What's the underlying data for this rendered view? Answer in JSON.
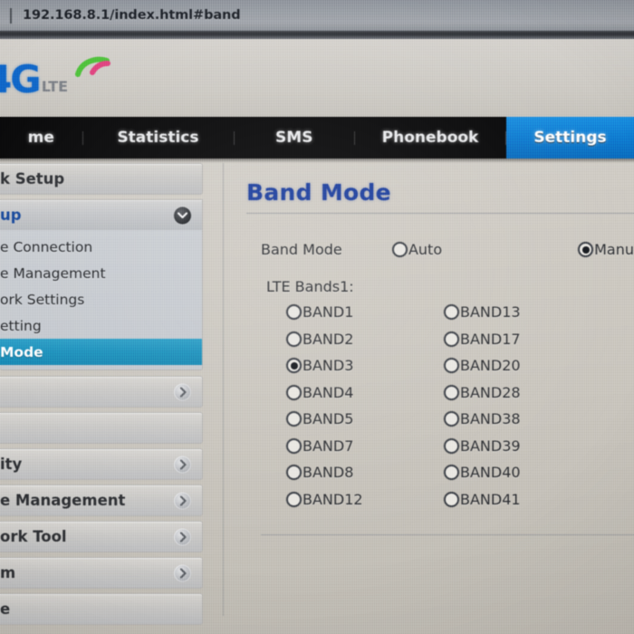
{
  "browser": {
    "url": "192.168.8.1/index.html#band"
  },
  "brand": {
    "primary_text": "4G",
    "secondary_text": "LTE",
    "color_4g": "#1066c8",
    "color_lte": "#7b7f86"
  },
  "nav": {
    "active_color": "#0f7bd0",
    "items": [
      {
        "label": "me",
        "active": false
      },
      {
        "label": "Statistics",
        "active": false
      },
      {
        "label": "SMS",
        "active": false
      },
      {
        "label": "Phonebook",
        "active": false
      },
      {
        "label": "Settings",
        "active": true
      }
    ]
  },
  "sidebar": {
    "selected_color": "#1b90bc",
    "sections": [
      {
        "label": "k Setup",
        "open": false,
        "chevron": "chevron-right-icon",
        "has_chevron": false,
        "items": []
      },
      {
        "label": "up",
        "open": true,
        "chevron": "chevron-down-icon",
        "has_chevron": true,
        "items": [
          {
            "label": "e Connection",
            "selected": false
          },
          {
            "label": "e Management",
            "selected": false
          },
          {
            "label": "ork Settings",
            "selected": false
          },
          {
            "label": "etting",
            "selected": false
          },
          {
            "label": "Mode",
            "selected": true
          }
        ]
      },
      {
        "label": "",
        "open": false,
        "chevron": "chevron-right-icon",
        "has_chevron": true,
        "items": []
      },
      {
        "label": "",
        "open": false,
        "chevron": "chevron-right-icon",
        "has_chevron": false,
        "items": []
      },
      {
        "label": "ity",
        "open": false,
        "chevron": "chevron-right-icon",
        "has_chevron": true,
        "items": []
      },
      {
        "label": "e Management",
        "open": false,
        "chevron": "chevron-right-icon",
        "has_chevron": true,
        "items": []
      },
      {
        "label": "ork Tool",
        "open": false,
        "chevron": "chevron-right-icon",
        "has_chevron": true,
        "items": []
      },
      {
        "label": "m",
        "open": false,
        "chevron": "chevron-right-icon",
        "has_chevron": true,
        "items": []
      },
      {
        "label": "e",
        "open": false,
        "chevron": "chevron-right-icon",
        "has_chevron": false,
        "items": []
      }
    ]
  },
  "content": {
    "title": "Band Mode",
    "band_mode_label": "Band Mode",
    "mode_options": [
      {
        "label": "Auto",
        "selected": false
      },
      {
        "label": "Manu",
        "selected": true
      }
    ],
    "lte_bands_label": "LTE Bands1:",
    "bands_left": [
      {
        "label": "BAND1",
        "selected": false
      },
      {
        "label": "BAND2",
        "selected": false
      },
      {
        "label": "BAND3",
        "selected": true
      },
      {
        "label": "BAND4",
        "selected": false
      },
      {
        "label": "BAND5",
        "selected": false
      },
      {
        "label": "BAND7",
        "selected": false
      },
      {
        "label": "BAND8",
        "selected": false
      },
      {
        "label": "BAND12",
        "selected": false
      }
    ],
    "bands_right": [
      {
        "label": "BAND13",
        "selected": false
      },
      {
        "label": "BAND17",
        "selected": false
      },
      {
        "label": "BAND20",
        "selected": false
      },
      {
        "label": "BAND28",
        "selected": false
      },
      {
        "label": "BAND38",
        "selected": false
      },
      {
        "label": "BAND39",
        "selected": false
      },
      {
        "label": "BAND40",
        "selected": false
      },
      {
        "label": "BAND41",
        "selected": false
      }
    ]
  }
}
